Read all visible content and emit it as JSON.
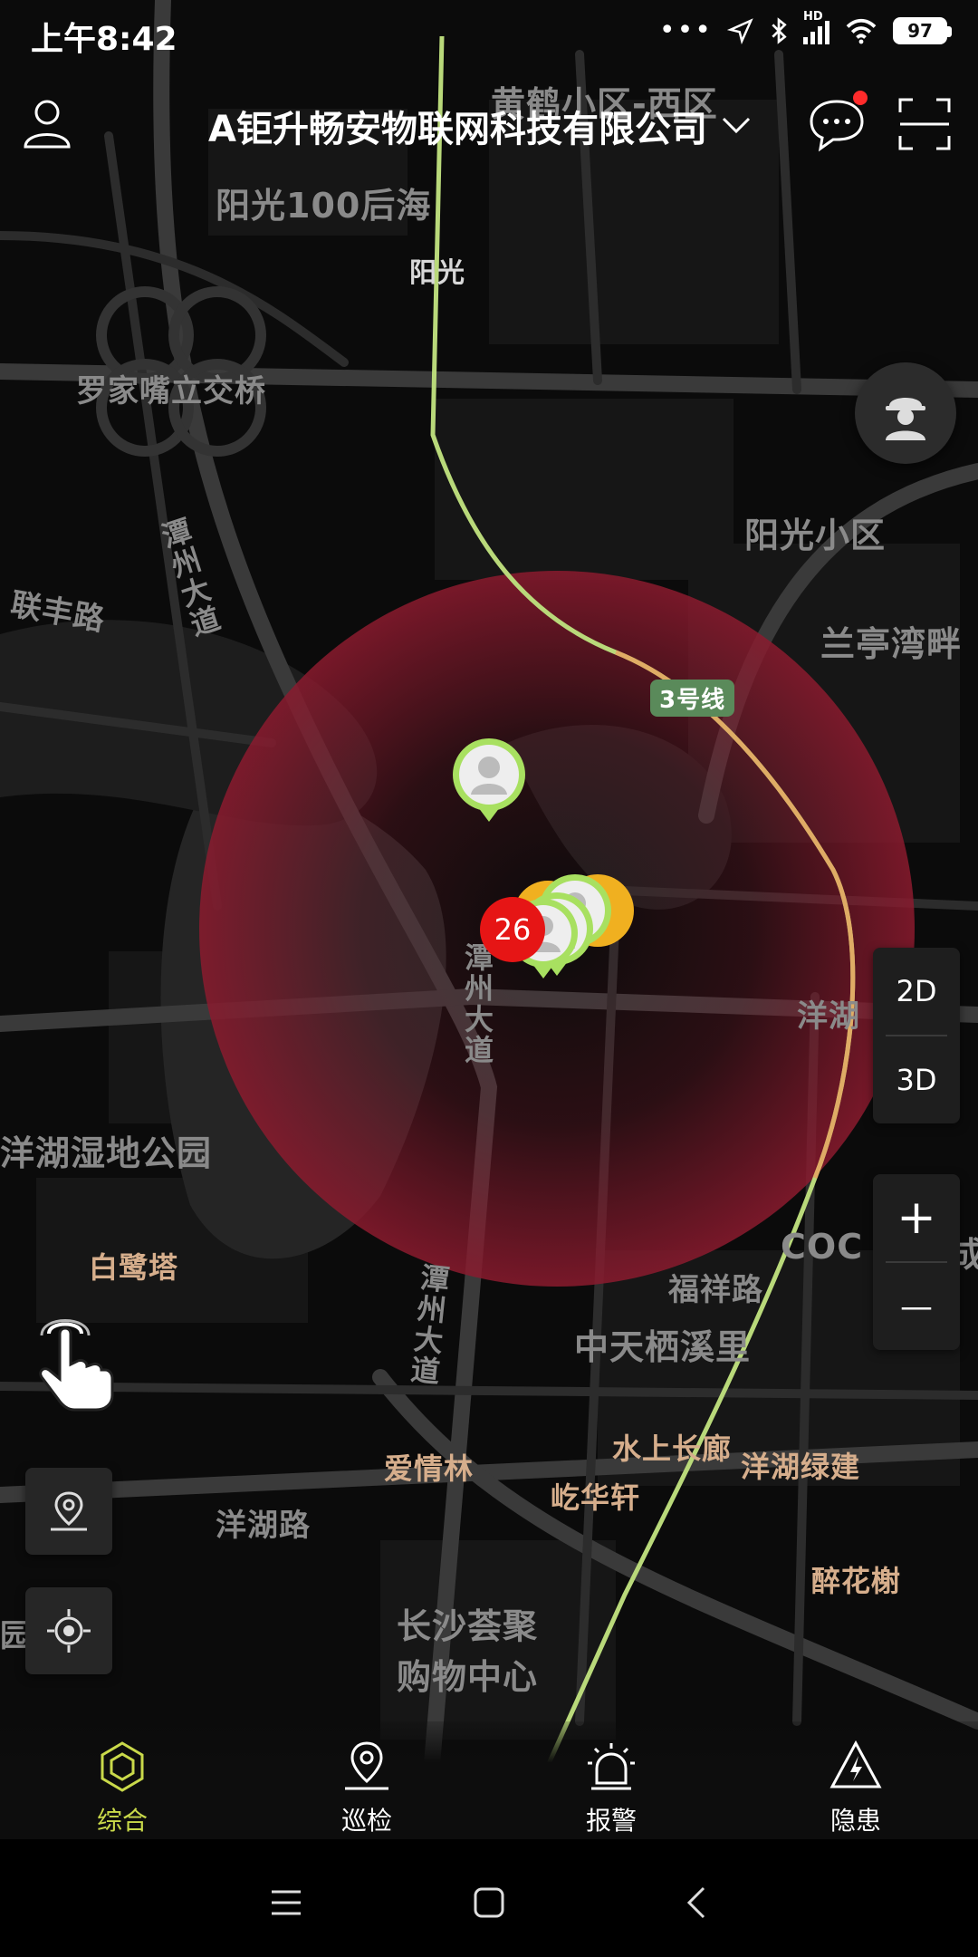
{
  "status_bar": {
    "time": "上午8:42",
    "battery": "97",
    "network_label": "HD"
  },
  "header": {
    "company": "A钜升畅安物联网科技有限公司"
  },
  "map": {
    "labels": [
      {
        "text": "黄鹤小区-西区",
        "style": "big"
      },
      {
        "text": "阳光100后海",
        "style": "big"
      },
      {
        "text": "阳光",
        "style": "white"
      },
      {
        "text": "罗家嘴立交桥",
        "style": ""
      },
      {
        "text": "阳光小区",
        "style": "big"
      },
      {
        "text": "联丰路",
        "style": ""
      },
      {
        "text": "潭州大道",
        "style": "vert"
      },
      {
        "text": "兰亭湾畔",
        "style": "big"
      },
      {
        "text": "3号线",
        "style": "metro"
      },
      {
        "text": "潭州大道",
        "style": "vert"
      },
      {
        "text": "洋湖",
        "style": ""
      },
      {
        "text": "洋湖湿地公园",
        "style": "big"
      },
      {
        "text": "白鹭塔",
        "style": "warm"
      },
      {
        "text": "COC",
        "style": "big"
      },
      {
        "text": "成",
        "style": "big"
      },
      {
        "text": "福祥路",
        "style": ""
      },
      {
        "text": "潭州大道",
        "style": "vert"
      },
      {
        "text": "中天栖溪里",
        "style": "big"
      },
      {
        "text": "水上长廊",
        "style": "warm"
      },
      {
        "text": "洋湖绿建",
        "style": "warm"
      },
      {
        "text": "爱情林",
        "style": "warm"
      },
      {
        "text": "屹华轩",
        "style": "warm"
      },
      {
        "text": "洋湖路",
        "style": ""
      },
      {
        "text": "醉花榭",
        "style": "warm"
      },
      {
        "text": "长沙荟聚",
        "style": "big"
      },
      {
        "text": "购物中心",
        "style": "big"
      },
      {
        "text": "园",
        "style": ""
      }
    ],
    "cluster_count": "26",
    "colors": {
      "alert_zone": "#8b1a2e",
      "metro_line": "#b9d97a",
      "cluster": "#e61515",
      "marker_green": "#a8e060",
      "marker_orange": "#f0b020"
    }
  },
  "controls": {
    "view_2d": "2D",
    "view_3d": "3D",
    "zoom_in": "+",
    "zoom_out": "—"
  },
  "bottom_nav": [
    {
      "label": "综合",
      "icon": "hexagon-icon",
      "active": true
    },
    {
      "label": "巡检",
      "icon": "location-pin-icon",
      "active": false
    },
    {
      "label": "报警",
      "icon": "alarm-siren-icon",
      "active": false
    },
    {
      "label": "隐患",
      "icon": "hazard-bolt-icon",
      "active": false
    }
  ]
}
